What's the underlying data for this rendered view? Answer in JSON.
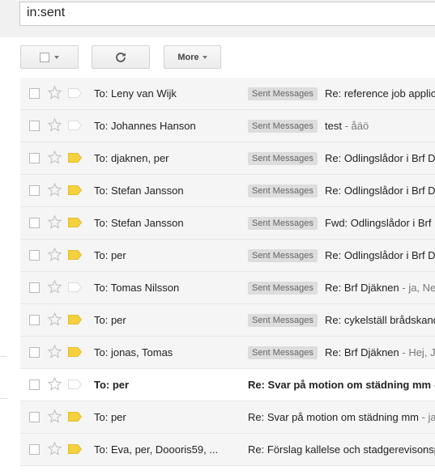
{
  "search": {
    "query": "in:sent"
  },
  "toolbar": {
    "more_label": "More"
  },
  "rows": [
    {
      "to": "To: Leny van Wijk",
      "badge": "Sent Messages",
      "subject": "Re: reference job applic",
      "snippet": "",
      "important": false,
      "unread": false
    },
    {
      "to": "To: Johannes Hanson",
      "badge": "Sent Messages",
      "subject": "test",
      "snippet": " - åäö",
      "important": false,
      "unread": false
    },
    {
      "to": "To: djaknen, per",
      "badge": "Sent Messages",
      "subject": "Re: Odlingslådor i Brf D",
      "snippet": "",
      "important": true,
      "unread": false
    },
    {
      "to": "To: Stefan Jansson",
      "badge": "Sent Messages",
      "subject": "Re: Odlingslådor i Brf D",
      "snippet": "",
      "important": true,
      "unread": false
    },
    {
      "to": "To: Stefan Jansson",
      "badge": "Sent Messages",
      "subject": "Fwd: Odlingslådor i Brf",
      "snippet": "",
      "important": true,
      "unread": false
    },
    {
      "to": "To: per",
      "badge": "Sent Messages",
      "subject": "Re: Odlingslådor i Brf D",
      "snippet": "",
      "important": true,
      "unread": false
    },
    {
      "to": "To: Tomas Nilsson",
      "badge": "Sent Messages",
      "subject": "Re: Brf Djäknen",
      "snippet": " - ja, Ne",
      "important": false,
      "unread": false
    },
    {
      "to": "To: per",
      "badge": "Sent Messages",
      "subject": "Re: cykelställ brådskand",
      "snippet": "",
      "important": true,
      "unread": false
    },
    {
      "to": "To: jonas, Tomas",
      "badge": "Sent Messages",
      "subject": "Re: Brf Djäknen",
      "snippet": " - Hej, J",
      "important": true,
      "unread": false
    },
    {
      "to": "To: per",
      "badge": "",
      "subject": "Re: Svar på motion om städning mm",
      "snippet": " - ",
      "important": false,
      "unread": true
    },
    {
      "to": "To: per",
      "badge": "",
      "subject": "Re: Svar på motion om städning mm",
      "snippet": " - ja",
      "important": true,
      "unread": false
    },
    {
      "to": "To: Eva, per, Doooris59, ...",
      "badge": "",
      "subject": "Re: Förslag kallelse och stadgerevisonsp",
      "snippet": "",
      "important": true,
      "unread": false
    }
  ],
  "colors": {
    "important": "#f4d13d",
    "not_important": "#dddddd"
  },
  "icons": {
    "refresh": "refresh-icon",
    "star": "star-icon",
    "label": "importance-marker-icon"
  }
}
